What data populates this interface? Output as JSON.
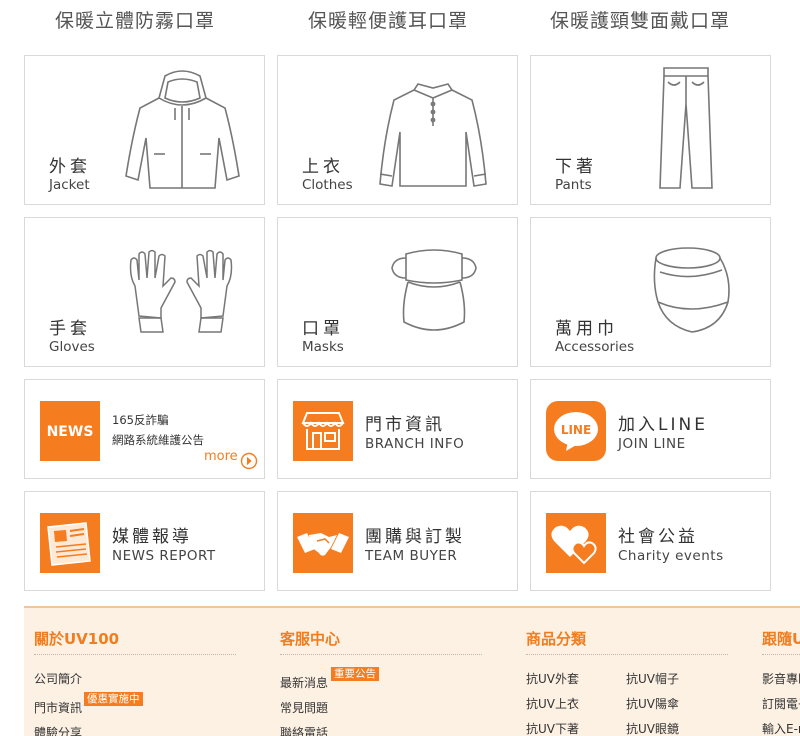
{
  "promos": [
    "保暖立體防霧口罩",
    "保暖輕便護耳口罩",
    "保暖護頸雙面戴口罩"
  ],
  "categories": [
    {
      "zh": "外套",
      "en": "Jacket",
      "icon": "jacket-icon"
    },
    {
      "zh": "上衣",
      "en": "Clothes",
      "icon": "shirt-icon"
    },
    {
      "zh": "下著",
      "en": "Pants",
      "icon": "pants-icon"
    },
    {
      "zh": "手套",
      "en": "Gloves",
      "icon": "gloves-icon"
    },
    {
      "zh": "口罩",
      "en": "Masks",
      "icon": "mask-icon"
    },
    {
      "zh": "萬用巾",
      "en": "Accessories",
      "icon": "neck-gaiter-icon"
    }
  ],
  "news": {
    "badge": "NEWS",
    "lines": [
      "165反詐騙",
      "網路系統維護公告"
    ],
    "more": "more"
  },
  "tiles": [
    {
      "zh": "門市資訊",
      "en": "BRANCH INFO",
      "icon": "store-icon"
    },
    {
      "zh": "加入LINE",
      "en": "JOIN LINE",
      "icon": "line-icon",
      "badge": "LINE"
    },
    {
      "zh": "媒體報導",
      "en": "NEWS REPORT",
      "icon": "newspaper-icon"
    },
    {
      "zh": "團購與訂製",
      "en": "TEAM BUYER",
      "icon": "handshake-icon"
    },
    {
      "zh": "社會公益",
      "en": "Charity events",
      "icon": "hearts-icon"
    }
  ],
  "footer": {
    "about": {
      "title": "關於UV100",
      "links": [
        "公司簡介",
        "門市資訊",
        "體驗分享"
      ],
      "badge": "優惠實施中"
    },
    "service": {
      "title": "客服中心",
      "links": [
        "最新消息",
        "常見問題",
        "聯絡電話"
      ],
      "badge": "重要公告"
    },
    "products": {
      "title": "商品分類",
      "col1": [
        "抗UV外套",
        "抗UV上衣",
        "抗UV下著"
      ],
      "col2": [
        "抗UV帽子",
        "抗UV陽傘",
        "抗UV眼鏡"
      ]
    },
    "follow": {
      "title": "跟隨UV",
      "links": [
        "影音專區",
        "訂閱電子報",
        "輸入E-mail"
      ]
    }
  },
  "colors": {
    "accent": "#f57c1f",
    "footer_bg": "#fdf1e4",
    "border": "#d9d9d9"
  }
}
